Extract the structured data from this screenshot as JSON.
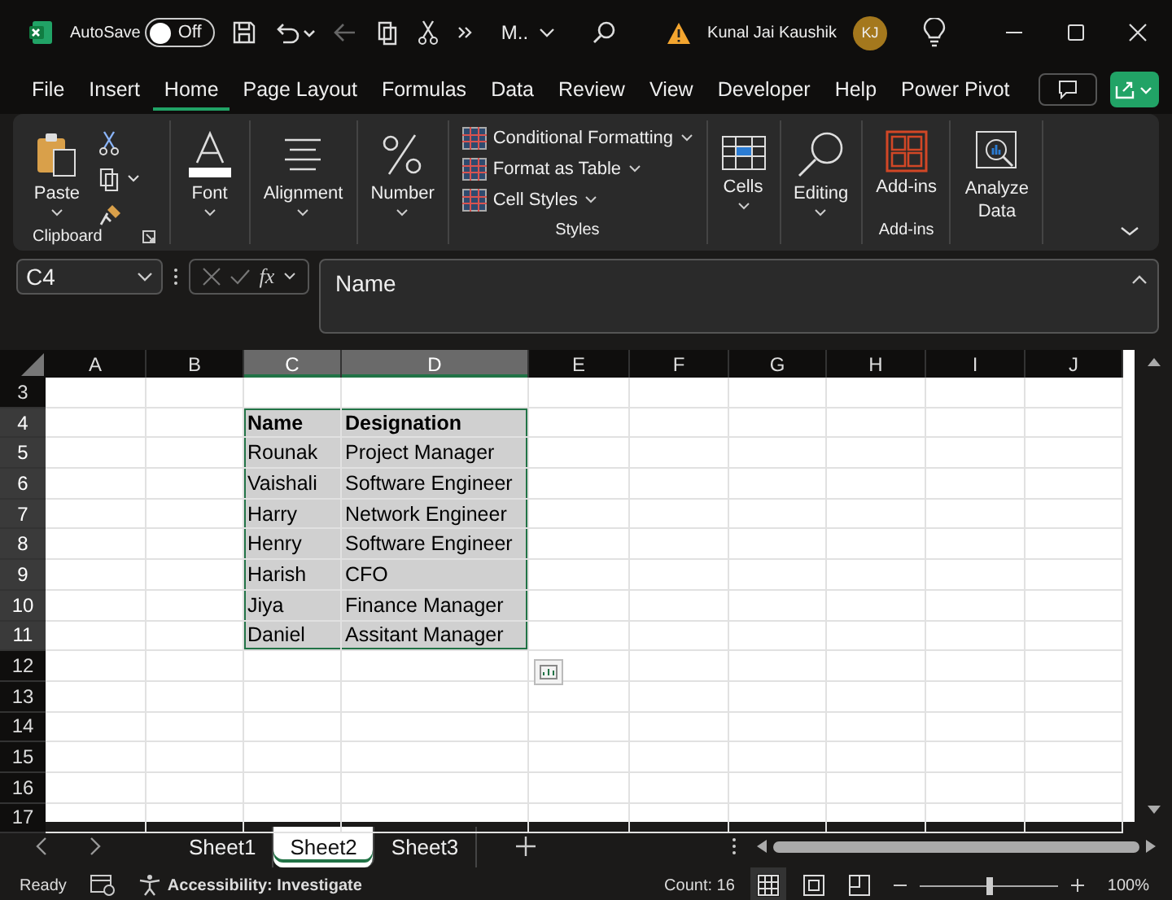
{
  "title_bar": {
    "autosave_label": "AutoSave",
    "autosave": {
      "label": "Off",
      "on": false
    },
    "file_name": "M..",
    "user_name": "Kunal Jai Kaushik",
    "avatar_initials": "KJ"
  },
  "menu_tabs": [
    {
      "label": "File",
      "selected": false
    },
    {
      "label": "Insert",
      "selected": false
    },
    {
      "label": "Home",
      "selected": true
    },
    {
      "label": "Page Layout",
      "selected": false
    },
    {
      "label": "Formulas",
      "selected": false
    },
    {
      "label": "Data",
      "selected": false
    },
    {
      "label": "Review",
      "selected": false
    },
    {
      "label": "View",
      "selected": false
    },
    {
      "label": "Developer",
      "selected": false
    },
    {
      "label": "Help",
      "selected": false
    },
    {
      "label": "Power Pivot",
      "selected": false
    }
  ],
  "ribbon": {
    "paste": "Paste",
    "clipboard_label": "Clipboard",
    "font": "Font",
    "alignment": "Alignment",
    "number": "Number",
    "styles": [
      "Conditional Formatting",
      "Format as Table",
      "Cell Styles"
    ],
    "styles_label": "Styles",
    "cells": "Cells",
    "editing": "Editing",
    "addins": "Add-ins",
    "addins_label": "Add-ins",
    "analyze": "Analyze Data"
  },
  "formula_bar": {
    "name_box": "C4",
    "fx_label": "fx",
    "formula": "Name"
  },
  "sheet": {
    "columns": [
      {
        "label": "A",
        "selected": false
      },
      {
        "label": "B",
        "selected": false
      },
      {
        "label": "C",
        "selected": true
      },
      {
        "label": "D",
        "selected": true
      },
      {
        "label": "E",
        "selected": false
      },
      {
        "label": "F",
        "selected": false
      },
      {
        "label": "G",
        "selected": false
      },
      {
        "label": "H",
        "selected": false
      },
      {
        "label": "I",
        "selected": false
      },
      {
        "label": "J",
        "selected": false
      }
    ],
    "rows": [
      {
        "number": "3",
        "selected": false
      },
      {
        "number": "4",
        "selected": true,
        "kind": "header",
        "cells": [
          "Name",
          "Designation"
        ]
      },
      {
        "number": "5",
        "selected": true,
        "kind": "data",
        "cells": [
          "Rounak",
          "Project Manager"
        ]
      },
      {
        "number": "6",
        "selected": true,
        "kind": "data",
        "cells": [
          "Vaishali",
          "Software Engineer"
        ]
      },
      {
        "number": "7",
        "selected": true,
        "kind": "data",
        "cells": [
          "Harry",
          "Network Engineer"
        ]
      },
      {
        "number": "8",
        "selected": true,
        "kind": "data",
        "cells": [
          "Henry",
          "Software Engineer"
        ]
      },
      {
        "number": "9",
        "selected": true,
        "kind": "data",
        "cells": [
          "Harish",
          "CFO"
        ]
      },
      {
        "number": "10",
        "selected": true,
        "kind": "data",
        "cells": [
          "Jiya",
          "Finance Manager"
        ]
      },
      {
        "number": "11",
        "selected": true,
        "kind": "data",
        "cells": [
          "Daniel",
          "Assitant Manager"
        ]
      },
      {
        "number": "12",
        "selected": false
      },
      {
        "number": "13",
        "selected": false
      },
      {
        "number": "14",
        "selected": false
      },
      {
        "number": "15",
        "selected": false
      },
      {
        "number": "16",
        "selected": false
      },
      {
        "number": "17",
        "selected": false
      }
    ]
  },
  "sheet_tabs": [
    {
      "label": "Sheet1",
      "selected": false
    },
    {
      "label": "Sheet2",
      "selected": true
    },
    {
      "label": "Sheet3",
      "selected": false
    }
  ],
  "status_bar": {
    "ready": "Ready",
    "accessibility": "Accessibility: Investigate",
    "count": "Count: 16",
    "zoom": {
      "level": 0.5,
      "reading": "100%"
    }
  }
}
